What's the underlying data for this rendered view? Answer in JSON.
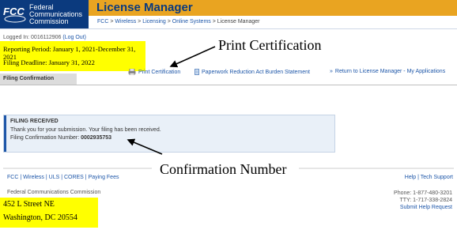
{
  "header": {
    "logo_text": "FCC",
    "agency_lines": [
      "Federal",
      "Communications",
      "Commission"
    ],
    "app_title": "License Manager",
    "breadcrumb": [
      "FCC",
      "Wireless",
      "Licensing",
      "Online Systems",
      "License Manager"
    ],
    "colors": {
      "navy": "#0b3a7e",
      "gold": "#e9a421"
    }
  },
  "session": {
    "logged_in_label": "Logged In: 0016112906",
    "logout_label": "(Log Out)"
  },
  "callout_top": {
    "reporting_period": "Reporting Period:  January 1, 2021-December 31, 2021",
    "filing_deadline": "Filing Deadline:  January 31, 2022"
  },
  "annotations": {
    "print_certification": "Print Certification",
    "confirmation_number": "Confirmation Number"
  },
  "tabs": {
    "active": "Filing Confirmation"
  },
  "toolbar": {
    "print_label": "Print Certification",
    "paperwork_label": "Paperwork Reduction Act Burden Statement",
    "return_label": "Return to License Manager - My Applications",
    "icons": [
      "printer-icon",
      "document-icon",
      "double-chevron-right-icon"
    ]
  },
  "confirmation": {
    "title": "FILING RECEIVED",
    "message": "Thank you for your submission. Your filing has been received.",
    "number_label": "Filing Confirmation Number:",
    "number_value": "0002935753"
  },
  "footer": {
    "links": "FCC | Wireless | ULS | CORES | Paying Fees",
    "help": "Help | Tech Support",
    "org": "Federal Communications Commission",
    "phone": "Phone: 1-877-480-3201",
    "tty": "TTY: 1-717-338-2824",
    "submit_help": "Submit Help Request"
  },
  "callout_bottom": {
    "address_line1": "452 L Street NE",
    "address_line2": "Washington, DC 20554"
  }
}
